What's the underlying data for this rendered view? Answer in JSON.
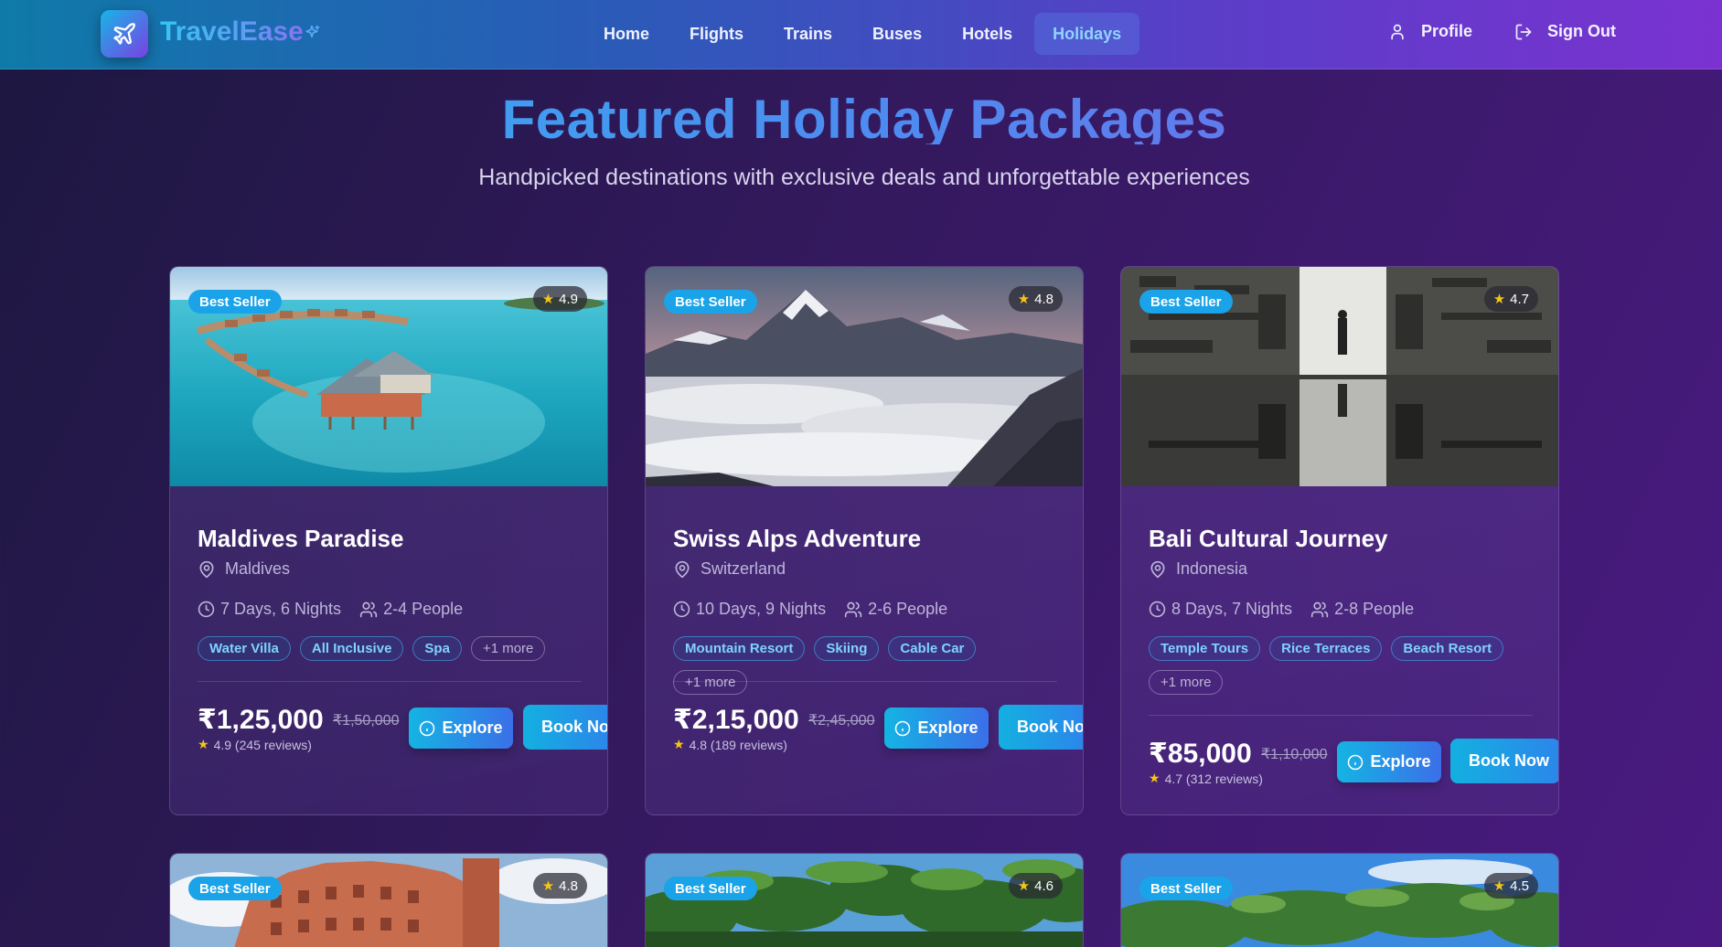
{
  "brand": {
    "name": "TravelEase"
  },
  "nav": {
    "links": [
      {
        "label": "Home"
      },
      {
        "label": "Flights"
      },
      {
        "label": "Trains"
      },
      {
        "label": "Buses"
      },
      {
        "label": "Hotels"
      },
      {
        "label": "Holidays",
        "active": true
      }
    ],
    "profile_label": "Profile",
    "signout_label": "Sign Out"
  },
  "hero": {
    "title": "Featured Holiday Packages",
    "subtitle": "Handpicked destinations with exclusive deals and unforgettable experiences"
  },
  "packages": [
    {
      "badge": "Best Seller",
      "rating": "4.9",
      "title": "Maldives Paradise",
      "location": "Maldives",
      "duration": "7 Days, 6 Nights",
      "people": "2-4 People",
      "tags": [
        "Water Villa",
        "All Inclusive",
        "Spa"
      ],
      "more": "+1 more",
      "price": "₹1,25,000",
      "old_price": "₹1,50,000",
      "reviews": "4.9 (245 reviews)",
      "explore_label": "Explore",
      "book_label": "Book Now"
    },
    {
      "badge": "Best Seller",
      "rating": "4.8",
      "title": "Swiss Alps Adventure",
      "location": "Switzerland",
      "duration": "10 Days, 9 Nights",
      "people": "2-6 People",
      "tags": [
        "Mountain Resort",
        "Skiing",
        "Cable Car"
      ],
      "more": "+1 more",
      "price": "₹2,15,000",
      "old_price": "₹2,45,000",
      "reviews": "4.8 (189 reviews)",
      "explore_label": "Explore",
      "book_label": "Book Now"
    },
    {
      "badge": "Best Seller",
      "rating": "4.7",
      "title": "Bali Cultural Journey",
      "location": "Indonesia",
      "duration": "8 Days, 7 Nights",
      "people": "2-8 People",
      "tags": [
        "Temple Tours",
        "Rice Terraces",
        "Beach Resort"
      ],
      "more": "+1 more",
      "price": "₹85,000",
      "old_price": "₹1,10,000",
      "reviews": "4.7 (312 reviews)",
      "explore_label": "Explore",
      "book_label": "Book Now"
    },
    {
      "badge": "Best Seller",
      "rating": "4.8"
    },
    {
      "badge": "Best Seller",
      "rating": "4.6"
    },
    {
      "badge": "Best Seller",
      "rating": "4.5"
    }
  ],
  "colors": {
    "accent_cyan": "#1aa3e8",
    "accent_purple": "#7a32d0",
    "star": "#f5c518"
  },
  "icons": {
    "logo": "airplane-icon",
    "sparkle": "sparkle-icon",
    "profile": "user-icon",
    "signout": "logout-icon",
    "location": "map-pin-icon",
    "duration": "clock-icon",
    "people": "users-icon",
    "explore": "info-icon",
    "rating": "star-icon"
  }
}
